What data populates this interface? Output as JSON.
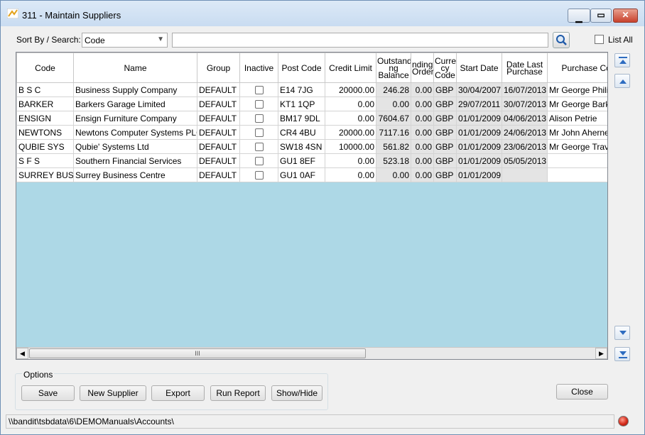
{
  "window": {
    "title": "311 - Maintain Suppliers",
    "accent": "#c9dcf1"
  },
  "search": {
    "sort_label": "Sort By / Search:",
    "sort_value": "Code",
    "query": "",
    "list_all_label": "List All"
  },
  "grid": {
    "columns": [
      {
        "key": "code",
        "label": "Code"
      },
      {
        "key": "name",
        "label": "Name"
      },
      {
        "key": "group",
        "label": "Group"
      },
      {
        "key": "inactive",
        "label": "Inactive"
      },
      {
        "key": "post_code",
        "label": "Post Code"
      },
      {
        "key": "credit_limit",
        "label": "Credit Limit"
      },
      {
        "key": "outstanding_balance",
        "label": "Outstand ng Balance"
      },
      {
        "key": "pending_orders",
        "label": "nding Orders"
      },
      {
        "key": "currency_code",
        "label": "Curre cy Code"
      },
      {
        "key": "start_date",
        "label": "Start Date"
      },
      {
        "key": "date_last_purchase",
        "label": "Date Last Purchase"
      },
      {
        "key": "purchase_contact",
        "label": "Purchase Conta"
      }
    ],
    "rows": [
      {
        "code": "B S C",
        "name": "Business Supply Company",
        "group": "DEFAULT",
        "inactive": false,
        "post_code": "E14 7JG",
        "credit_limit": "20000.00",
        "outstanding_balance": "246.28",
        "pending_orders": "0.00",
        "currency_code": "GBP",
        "start_date": "30/04/2007",
        "date_last_purchase": "16/07/2013",
        "purchase_contact": "Mr George Philip"
      },
      {
        "code": "BARKER",
        "name": "Barkers Garage Limited",
        "group": "DEFAULT",
        "inactive": false,
        "post_code": "KT1 1QP",
        "credit_limit": "0.00",
        "outstanding_balance": "0.00",
        "pending_orders": "0.00",
        "currency_code": "GBP",
        "start_date": "29/07/2011",
        "date_last_purchase": "30/07/2013",
        "purchase_contact": "Mr George Barke"
      },
      {
        "code": "ENSIGN",
        "name": "Ensign Furniture Company",
        "group": "DEFAULT",
        "inactive": false,
        "post_code": "BM17 9DL",
        "credit_limit": "0.00",
        "outstanding_balance": "7604.67",
        "pending_orders": "0.00",
        "currency_code": "GBP",
        "start_date": "01/01/2009",
        "date_last_purchase": "04/06/2013",
        "purchase_contact": "Alison Petrie"
      },
      {
        "code": "NEWTONS",
        "name": "Newtons Computer Systems PLC",
        "group": "DEFAULT",
        "inactive": false,
        "post_code": "CR4 4BU",
        "credit_limit": "20000.00",
        "outstanding_balance": "7117.16",
        "pending_orders": "0.00",
        "currency_code": "GBP",
        "start_date": "01/01/2009",
        "date_last_purchase": "24/06/2013",
        "purchase_contact": "Mr John Aherne"
      },
      {
        "code": "QUBIE SYS",
        "name": "Qubie' Systems Ltd",
        "group": "DEFAULT",
        "inactive": false,
        "post_code": "SW18 4SN",
        "credit_limit": "10000.00",
        "outstanding_balance": "561.82",
        "pending_orders": "0.00",
        "currency_code": "GBP",
        "start_date": "01/01/2009",
        "date_last_purchase": "23/06/2013",
        "purchase_contact": "Mr George Travis"
      },
      {
        "code": "S F S",
        "name": "Southern Financial Services",
        "group": "DEFAULT",
        "inactive": false,
        "post_code": "GU1 8EF",
        "credit_limit": "0.00",
        "outstanding_balance": "523.18",
        "pending_orders": "0.00",
        "currency_code": "GBP",
        "start_date": "01/01/2009",
        "date_last_purchase": "05/05/2013",
        "purchase_contact": ""
      },
      {
        "code": "SURREY BUS",
        "name": "Surrey Business Centre",
        "group": "DEFAULT",
        "inactive": false,
        "post_code": "GU1 0AF",
        "credit_limit": "0.00",
        "outstanding_balance": "0.00",
        "pending_orders": "0.00",
        "currency_code": "GBP",
        "start_date": "01/01/2009",
        "date_last_purchase": "",
        "purchase_contact": ""
      }
    ],
    "background_color": "#add8e6",
    "scroll_grip": "III"
  },
  "options": {
    "label": "Options",
    "buttons": {
      "save": "Save",
      "new_supplier": "New Supplier",
      "export": "Export",
      "run_report": "Run Report",
      "show_hide": "Show/Hide"
    }
  },
  "close_label": "Close",
  "status": {
    "path": "\\\\bandit\\tsbdata\\6\\DEMOManuals\\Accounts\\",
    "indicator_color": "#d42a1a"
  }
}
